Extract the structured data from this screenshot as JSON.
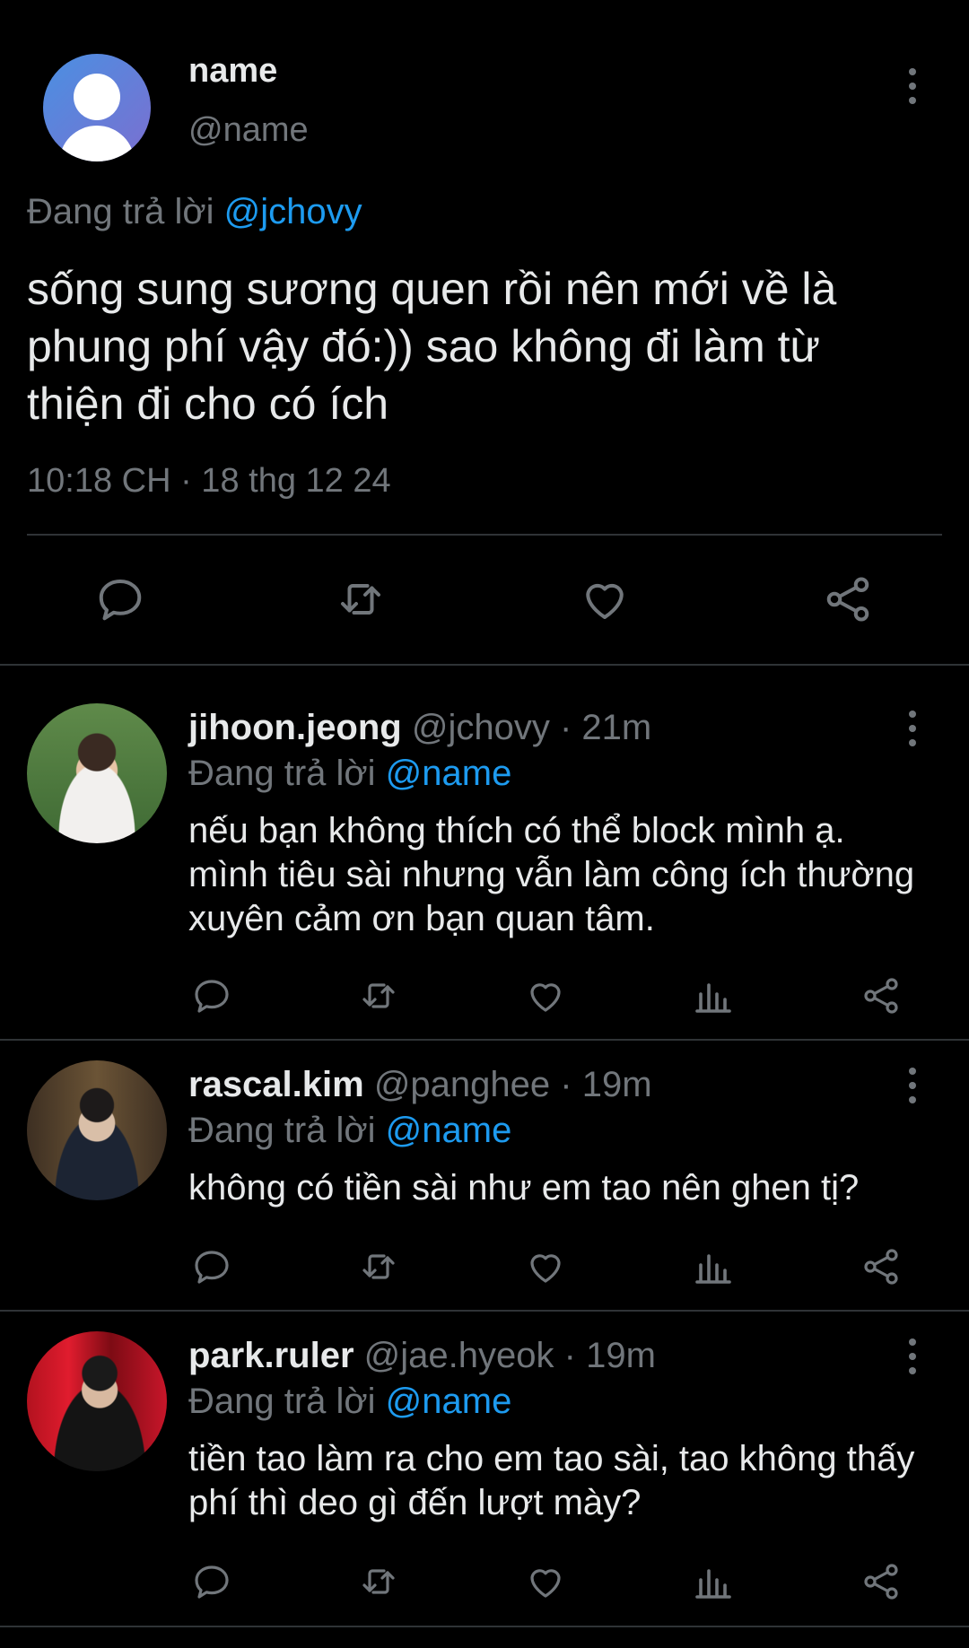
{
  "main_tweet": {
    "display_name": "name",
    "handle": "@name",
    "replying_prefix": "Đang trả lời",
    "replying_to": "@jchovy",
    "text": "sống sung sương quen rồi nên mới về là phung phí vậy đó:)) sao không đi làm từ thiện đi cho có ích",
    "timestamp": "10:18 CH · 18 thg 12 24",
    "actions": [
      "reply-icon",
      "retweet-icon",
      "like-icon",
      "share-icon"
    ]
  },
  "replies": [
    {
      "display_name": "jihoon.jeong",
      "handle": "@jchovy",
      "time": "21m",
      "replying_prefix": "Đang trả lời",
      "replying_to": "@name",
      "text": "nếu bạn không thích có thể block mình ạ. mình tiêu sài nhưng vẫn làm công ích thường xuyên cảm ơn bạn quan tâm."
    },
    {
      "display_name": "rascal.kim",
      "handle": "@panghee",
      "time": "19m",
      "replying_prefix": "Đang trả lời",
      "replying_to": "@name",
      "text": "không có tiền sài như em tao nên ghen tị?"
    },
    {
      "display_name": "park.ruler",
      "handle": "@jae.hyeok",
      "time": "19m",
      "replying_prefix": "Đang trả lời",
      "replying_to": "@name",
      "text": "tiền tao làm ra cho em tao sài, tao không thấy phí thì deo gì đến lượt mày?"
    }
  ],
  "reply_actions": [
    "reply-icon",
    "retweet-icon",
    "like-icon",
    "views-icon",
    "share-icon"
  ],
  "colors": {
    "background": "#000000",
    "text": "#e7e9ea",
    "muted": "#71767b",
    "mention": "#1d9bf0",
    "divider": "#2f3336"
  }
}
